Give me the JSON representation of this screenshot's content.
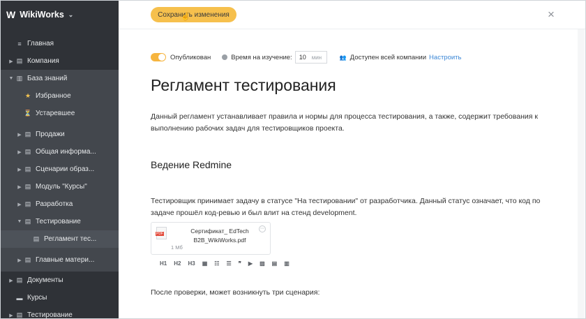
{
  "sidebar": {
    "brand": "WikiWorks",
    "items": [
      {
        "label": "Главная",
        "arrow": "",
        "icon": "≡"
      },
      {
        "label": "Компания",
        "arrow": "▶",
        "icon": "▤"
      },
      {
        "label": "База знаний",
        "arrow": "▼",
        "icon": "▥"
      },
      {
        "label": "Избранное",
        "arrow": "",
        "icon": "★"
      },
      {
        "label": "Устаревшее",
        "arrow": "",
        "icon": "⏳"
      },
      {
        "label": "Продажи",
        "arrow": "▶",
        "icon": "▤"
      },
      {
        "label": "Общая информа...",
        "arrow": "▶",
        "icon": "▤"
      },
      {
        "label": "Сценарии образ...",
        "arrow": "▶",
        "icon": "▤"
      },
      {
        "label": "Модуль \"Курсы\"",
        "arrow": "▶",
        "icon": "▤"
      },
      {
        "label": "Разработка",
        "arrow": "▶",
        "icon": "▤"
      },
      {
        "label": "Тестирование",
        "arrow": "▼",
        "icon": "▤"
      },
      {
        "label": "Регламент тес...",
        "arrow": "",
        "icon": "▤"
      },
      {
        "label": "Главные матери...",
        "arrow": "▶",
        "icon": "▤"
      },
      {
        "label": "Документы",
        "arrow": "▶",
        "icon": "▤"
      },
      {
        "label": "Курсы",
        "arrow": "",
        "icon": "▬"
      },
      {
        "label": "Тестирование",
        "arrow": "▶",
        "icon": "▤"
      }
    ]
  },
  "topbar": {
    "save_label": "Сохранить изменения",
    "close_icon": "×"
  },
  "meta": {
    "published_label": "Опубликован",
    "study_time_label": "Время на изучение:",
    "study_time_value": "10",
    "study_time_unit": "мин",
    "access_label": "Доступен всей компании",
    "configure_link": "Настроить"
  },
  "article": {
    "title": "Регламент тестирования",
    "intro": "Данный регламент устанавливает правила и нормы для процесса тестирования, а также, содержит требования к выполнению рабочих задач для тестировщиков проекта.",
    "section_title": "Ведение Redmine",
    "paragraph": "Тестировщик принимает задачу в статусе \"На тестировании\" от разработчика. Данный статус означает, что код по задаче прошёл код-ревью и был влит на стенд development.",
    "attachment": {
      "name": "Сертификат_ EdTech B2B_WikiWorks.pdf",
      "size": "1 Мб",
      "badge": "PDF"
    },
    "toolbar": [
      "H1",
      "H2",
      "H3",
      "▦",
      "☷",
      "☰",
      "❞",
      "▶",
      "▨",
      "▤",
      "▥"
    ],
    "after_text": "После проверки, может возникнуть три сценария:"
  },
  "colors": {
    "accent": "#f6c04d",
    "sidebar_bg": "#2f3237",
    "link": "#3a86d6"
  }
}
